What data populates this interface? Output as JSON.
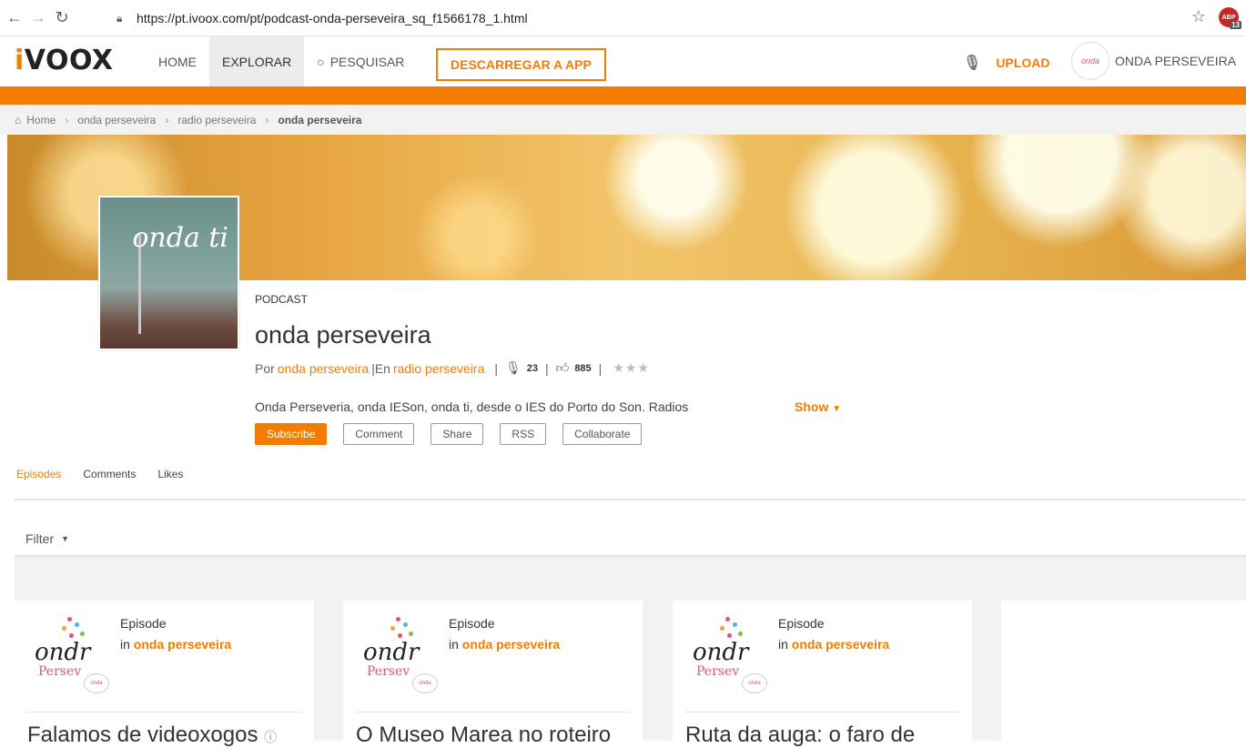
{
  "browser": {
    "url": "https://pt.ivoox.com/pt/podcast-onda-perseveira_sq_f1566178_1.html",
    "extension_badge": "13"
  },
  "header": {
    "logo": "iVOOX",
    "menu": [
      {
        "label": "HOME",
        "active": false
      },
      {
        "label": "EXPLORAR",
        "active": true
      },
      {
        "label": "PESQUISAR",
        "active": false
      }
    ],
    "app_button": "DESCARREGAR A APP",
    "upload": "UPLOAD",
    "user_name": "ONDA PERSEVEIRA",
    "accent_color": "#f47c00"
  },
  "breadcrumb": {
    "home": "Home",
    "items": [
      "onda perseveira",
      "radio perseveira"
    ],
    "current": "onda perseveira"
  },
  "podcast": {
    "label": "PODCAST",
    "title": "onda perseveira",
    "por_label": "Por",
    "author": "onda perseveira",
    "en_label": "En",
    "channel": "radio perseveira",
    "episodes_count": "23",
    "likes_count": "885",
    "rating": "★★★",
    "description": "Onda Perseveria, onda IESon, onda ti, desde o IES do Porto do Son. Radios",
    "show_label": "Show",
    "cover_text": "onda ti"
  },
  "actions": {
    "subscribe": "Subscribe",
    "comment": "Comment",
    "share": "Share",
    "rss": "RSS",
    "collaborate": "Collaborate"
  },
  "tabs": [
    {
      "label": "Episodes",
      "active": true
    },
    {
      "label": "Comments",
      "active": false
    },
    {
      "label": "Likes",
      "active": false
    }
  ],
  "filter": {
    "label": "Filter"
  },
  "episodes": [
    {
      "type_label": "Episode",
      "in_label": "in",
      "channel": "onda perseveira",
      "title": "Falamos de videoxogos"
    },
    {
      "type_label": "Episode",
      "in_label": "in",
      "channel": "onda perseveira",
      "title": "O Museo Marea no roteiro"
    },
    {
      "type_label": "Episode",
      "in_label": "in",
      "channel": "onda perseveira",
      "title": "Ruta da auga: o faro de"
    }
  ]
}
